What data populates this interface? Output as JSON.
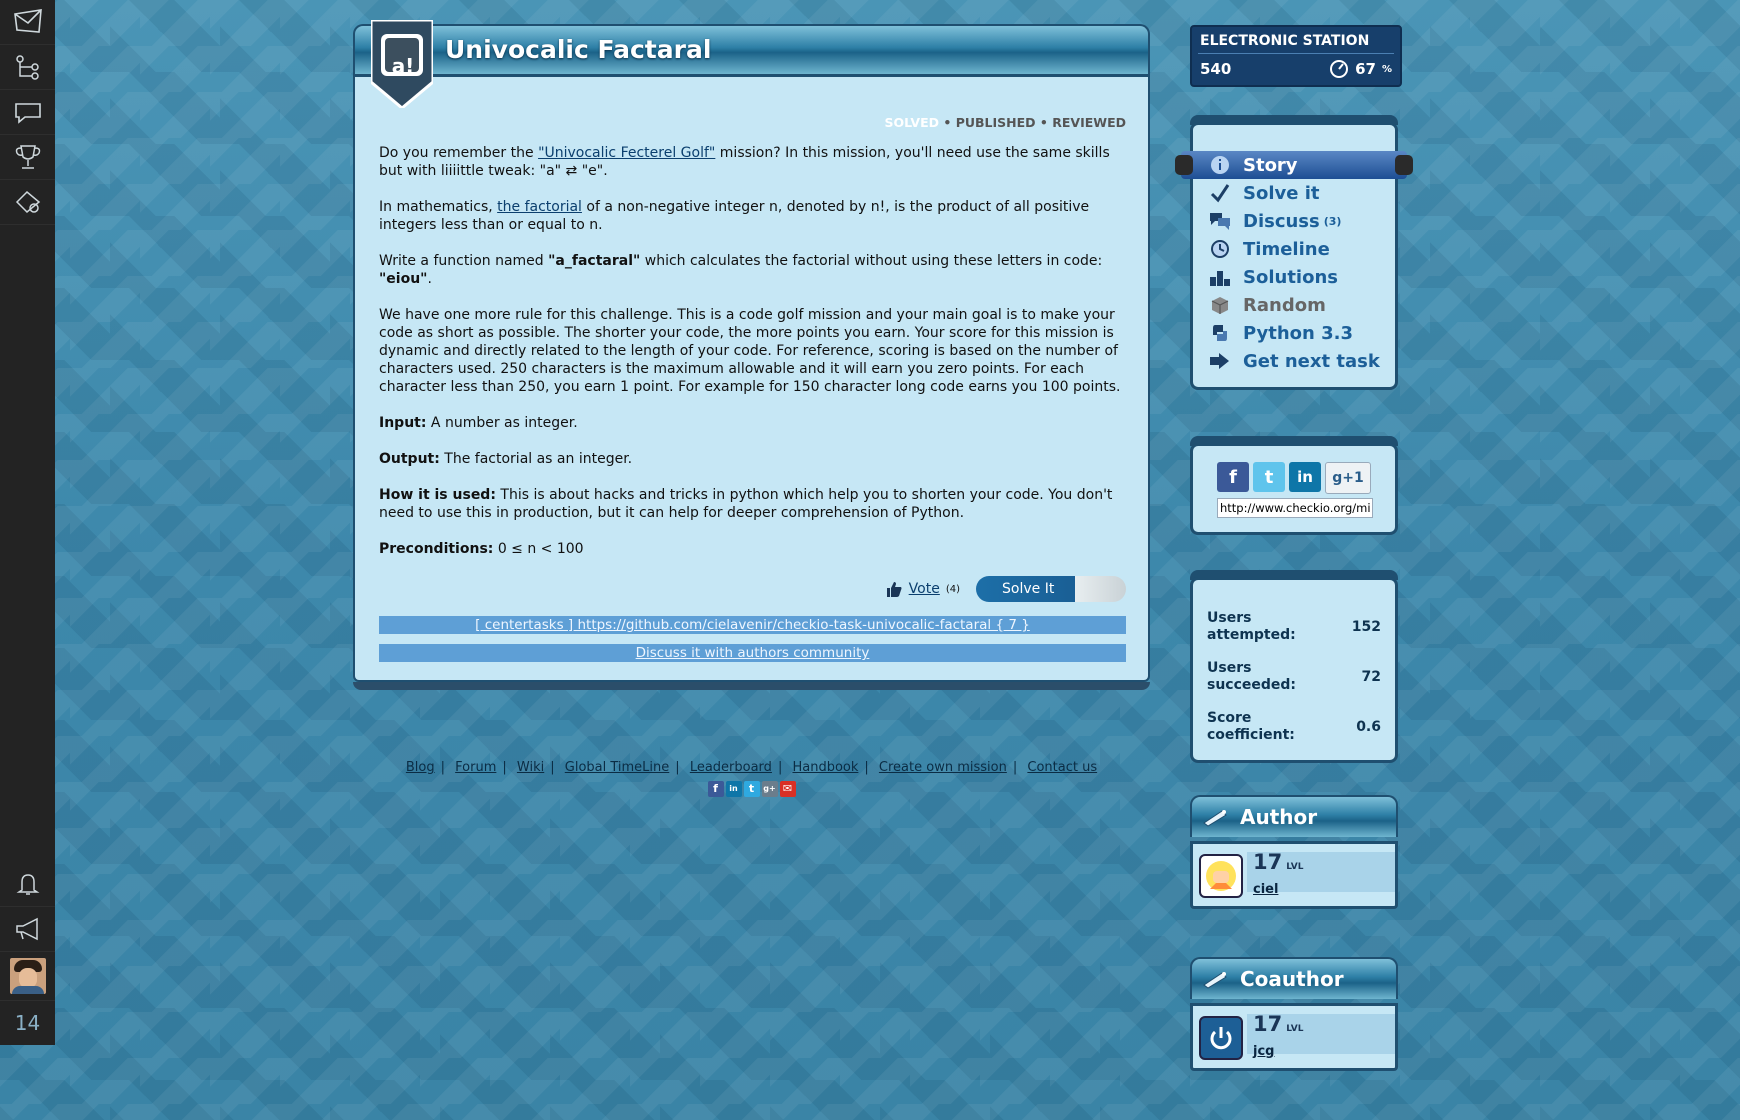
{
  "sidebar": {
    "icons": [
      "mail-icon",
      "tree-icon",
      "chat-bubble-icon",
      "trophy-icon",
      "settings-pin-icon"
    ],
    "bottom_icons": [
      "bell-icon",
      "megaphone-icon"
    ],
    "level": "14"
  },
  "mission": {
    "title": "Univocalic Factaral",
    "badge": "a!",
    "status": {
      "solved": "SOLVED",
      "published": "PUBLISHED",
      "reviewed": "REVIEWED",
      "separator": "•"
    },
    "p1_before": "Do you remember the ",
    "p1_link": "\"Univocalic Fecterel Golf\"",
    "p1_after": " mission? In this mission, you'll need use the same skills but with liiiittle tweak: \"a\" ⇄ \"e\".",
    "p2_before": "In mathematics, ",
    "p2_link": "the factorial",
    "p2_after": " of a non-negative integer n, denoted by n!, is the product of all positive integers less than or equal to n.",
    "p3_before": "Write a function named ",
    "p3_bold1": "\"a_factaral\"",
    "p3_mid": " which calculates the factorial without using these letters in code: ",
    "p3_bold2": "\"eiou\"",
    "p3_after": ".",
    "p4": "We have one more rule for this challenge. This is a code golf mission and your main goal is to make your code as short as possible. The shorter your code, the more points you earn. Your score for this mission is dynamic and directly related to the length of your code. For reference, scoring is based on the number of characters used. 250 characters is the maximum allowable and it will earn you zero points. For each character less than 250, you earn 1 point. For example for 150 character long code earns you 100 points.",
    "input_label": "Input:",
    "input_text": " A number as integer.",
    "output_label": "Output:",
    "output_text": " The factorial as an integer.",
    "how_label": "How it is used:",
    "how_text": " This is about hacks and tricks in python which help you to shorten your code. You don't need to use this in production, but it can help for deeper comprehension of Python.",
    "pre_label": "Preconditions:",
    "pre_text": " 0 ≤ n < 100",
    "vote_label": "Vote",
    "vote_count": "(4)",
    "solve_button": "Solve It",
    "github_link": "[ centertasks ] https://github.com/cielavenir/checkio-task-univocalic-factaral { 7 }",
    "discuss_link": "Discuss it with authors community"
  },
  "footer": {
    "links": [
      "Blog",
      "Forum",
      "Wiki",
      "Global TimeLine",
      "Leaderboard",
      "Handbook",
      "Create own mission",
      "Contact us"
    ],
    "separator": "|"
  },
  "station": {
    "title": "ELECTRONIC STATION",
    "score": "540",
    "percent": "67",
    "percent_sign": "%"
  },
  "menu": {
    "story": "Story",
    "solve": "Solve it",
    "discuss": "Discuss",
    "discuss_count": "(3)",
    "timeline": "Timeline",
    "solutions": "Solutions",
    "random": "Random",
    "python": "Python 3.3",
    "next": "Get next task"
  },
  "share": {
    "facebook": "f",
    "twitter": "t",
    "linkedin": "in",
    "gplus": "g+1",
    "url": "http://www.checkio.org/mission/univocalic-factaral/"
  },
  "stats": {
    "attempted_label": "Users attempted:",
    "attempted": "152",
    "succeeded_label": "Users succeeded:",
    "succeeded": "72",
    "coef_label": "Score coefficient:",
    "coef": "0.6"
  },
  "author": {
    "heading": "Author",
    "level": "17",
    "lvl_label": "LVL",
    "name": "ciel"
  },
  "coauthor": {
    "heading": "Coauthor",
    "level": "17",
    "lvl_label": "LVL",
    "name": "jcg"
  },
  "colors": {
    "accent": "#1c5f99",
    "panel": "#c6e7f5",
    "frame": "#1f4f70",
    "link_bar": "#5e9fd6"
  }
}
